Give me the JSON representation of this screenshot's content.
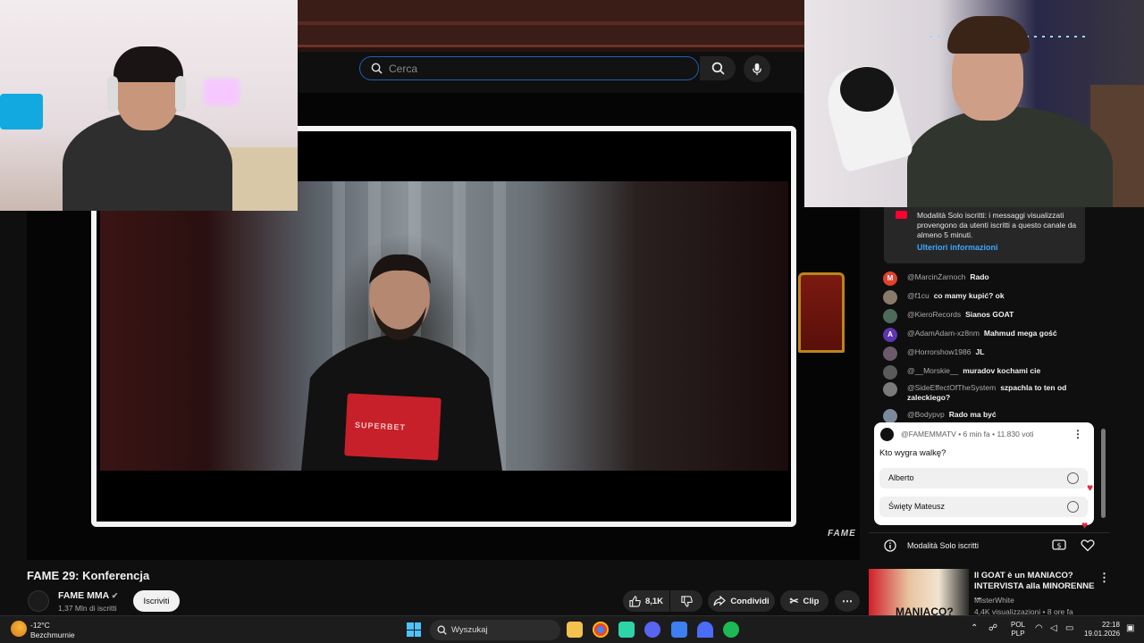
{
  "search": {
    "placeholder": "Cerca"
  },
  "video": {
    "title": "FAME 29: Konferencja",
    "folder_text": "SUPERBET",
    "watermark": "FAME"
  },
  "channel": {
    "name": "FAME MMA",
    "subscribers": "1,37 Mln di iscritti",
    "subscribe_label": "Iscriviti"
  },
  "actions": {
    "likes": "8,1K",
    "share_label": "Condividi",
    "clip_label": "Clip"
  },
  "chat": {
    "notice_text": "Modalità Solo iscritti: i messaggi visualizzati provengono da utenti iscritti a questo canale da almeno 5 minuti.",
    "notice_link": "Ulteriori informazioni",
    "messages": [
      {
        "author": "@MarcinŻarnoch",
        "text": "Rado",
        "avatar": "M",
        "color": "#e2412e"
      },
      {
        "author": "@f1cu",
        "text": "co mamy kupić? ok",
        "avatar": "",
        "color": "#8a7a6a"
      },
      {
        "author": "@KieroRecords",
        "text": "Sianos GOAT",
        "avatar": "",
        "color": "#4d6a5a"
      },
      {
        "author": "@AdamAdam-xz8nm",
        "text": "Mahmud mega gość",
        "avatar": "A",
        "color": "#5e35b1"
      },
      {
        "author": "@Horrorshow1986",
        "text": "JL",
        "avatar": "",
        "color": "#6a5a6a"
      },
      {
        "author": "@__Morskie__",
        "text": "muradov kochami cie",
        "avatar": "",
        "color": "#5a5a5a"
      },
      {
        "author": "@SideEffectOfTheSystem",
        "text": "szpachla to ten od zaleckiego?",
        "avatar": "",
        "color": "#7a7a7a"
      },
      {
        "author": "@Bodypvp",
        "text": "Rado ma być",
        "avatar": "",
        "color": "#7a8a9a"
      }
    ],
    "poll": {
      "header": "@FAMEMMATV • 6 min fa • 11.830 voti",
      "question": "Kto wygra walkę?",
      "options": [
        "Alberto",
        "Święty Mateusz"
      ]
    },
    "footer_label": "Modalità Solo iscritti"
  },
  "recommendation": {
    "title": "Il GOAT è un MANIACO? INTERVISTA alla MINORENNE ...",
    "channel": "MisterWhite",
    "meta": "4,4K visualizzazioni • 8 ore fa",
    "thumb_text": "MANIACO?"
  },
  "taskbar": {
    "temperature": "-12°C",
    "weather": "Bezchmurnie",
    "search_label": "Wyszukaj",
    "lang_top": "POL",
    "lang_bottom": "PLP",
    "time": "22:18",
    "date": "19.01.2026"
  },
  "colors": {
    "accent": "#3ea6ff",
    "brand_red": "#ff0033",
    "search_border": "#1c62b9"
  }
}
